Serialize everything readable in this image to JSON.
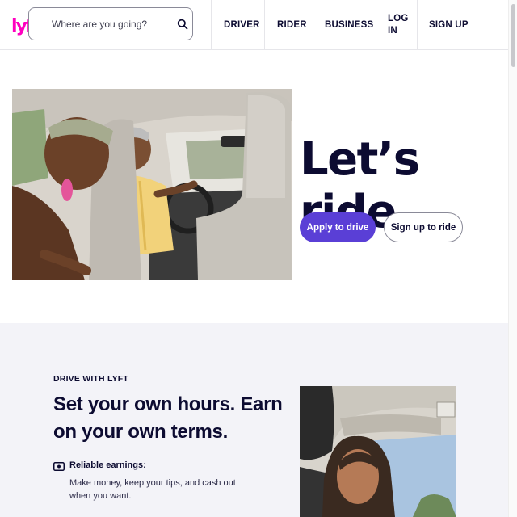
{
  "header": {
    "logo_text": "lyft",
    "search": {
      "placeholder": "Where are you going?"
    },
    "nav": {
      "driver": "DRIVER",
      "rider": "RIDER",
      "business": "BUSINESS",
      "login": "LOG IN",
      "signup": "SIGN UP"
    }
  },
  "hero": {
    "title": "Let’s ride",
    "apply_button": "Apply to drive",
    "signup_button": "Sign up to ride"
  },
  "drive": {
    "eyebrow": "DRIVE WITH LYFT",
    "title": "Set your own hours. Earn on your own terms.",
    "feature": {
      "icon": "cash-icon",
      "title": "Reliable earnings:",
      "description": "Make money, keep your tips, and cash out when you want."
    }
  },
  "colors": {
    "brand_pink": "#ff00bf",
    "primary_purple": "#5a3fd6",
    "text_navy": "#0c0b31",
    "section_bg": "#f3f3f8"
  }
}
